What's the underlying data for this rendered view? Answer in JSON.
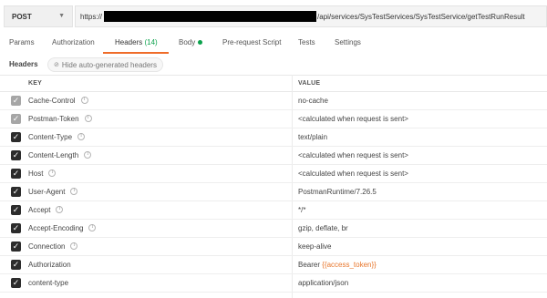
{
  "request": {
    "method": "POST",
    "url_prefix": "https://",
    "url_suffix": "/api/services/SysTestServices/SysTestService/getTestRunResult"
  },
  "tabs": [
    {
      "label": "Params"
    },
    {
      "label": "Authorization"
    },
    {
      "label": "Headers",
      "count": "(14)",
      "active": true
    },
    {
      "label": "Body",
      "indicator": "green-dot"
    },
    {
      "label": "Pre-request Script"
    },
    {
      "label": "Tests"
    },
    {
      "label": "Settings"
    }
  ],
  "headers_section": {
    "label": "Headers",
    "hide_button": "Hide auto-generated headers",
    "hide_icon": "eye-slash-icon"
  },
  "table": {
    "col_key": "KEY",
    "col_value": "VALUE",
    "rows": [
      {
        "key": "Cache-Control",
        "value": "no-cache",
        "checked": true,
        "auto": true,
        "info": true
      },
      {
        "key": "Postman-Token",
        "value": "<calculated when request is sent>",
        "checked": true,
        "auto": true,
        "info": true
      },
      {
        "key": "Content-Type",
        "value": "text/plain",
        "checked": true,
        "auto": false,
        "info": true
      },
      {
        "key": "Content-Length",
        "value": "<calculated when request is sent>",
        "checked": true,
        "auto": false,
        "info": true
      },
      {
        "key": "Host",
        "value": "<calculated when request is sent>",
        "checked": true,
        "auto": false,
        "info": true
      },
      {
        "key": "User-Agent",
        "value": "PostmanRuntime/7.26.5",
        "checked": true,
        "auto": false,
        "info": true
      },
      {
        "key": "Accept",
        "value": "*/*",
        "checked": true,
        "auto": false,
        "info": true
      },
      {
        "key": "Accept-Encoding",
        "value": "gzip, deflate, br",
        "checked": true,
        "auto": false,
        "info": true
      },
      {
        "key": "Connection",
        "value": "keep-alive",
        "checked": true,
        "auto": false,
        "info": true
      },
      {
        "key": "Authorization",
        "value_prefix": "Bearer ",
        "value_var": "{{access_token}}",
        "checked": true,
        "auto": false,
        "info": false
      },
      {
        "key": "content-type",
        "value": "application/json",
        "checked": true,
        "auto": false,
        "info": false
      }
    ]
  }
}
